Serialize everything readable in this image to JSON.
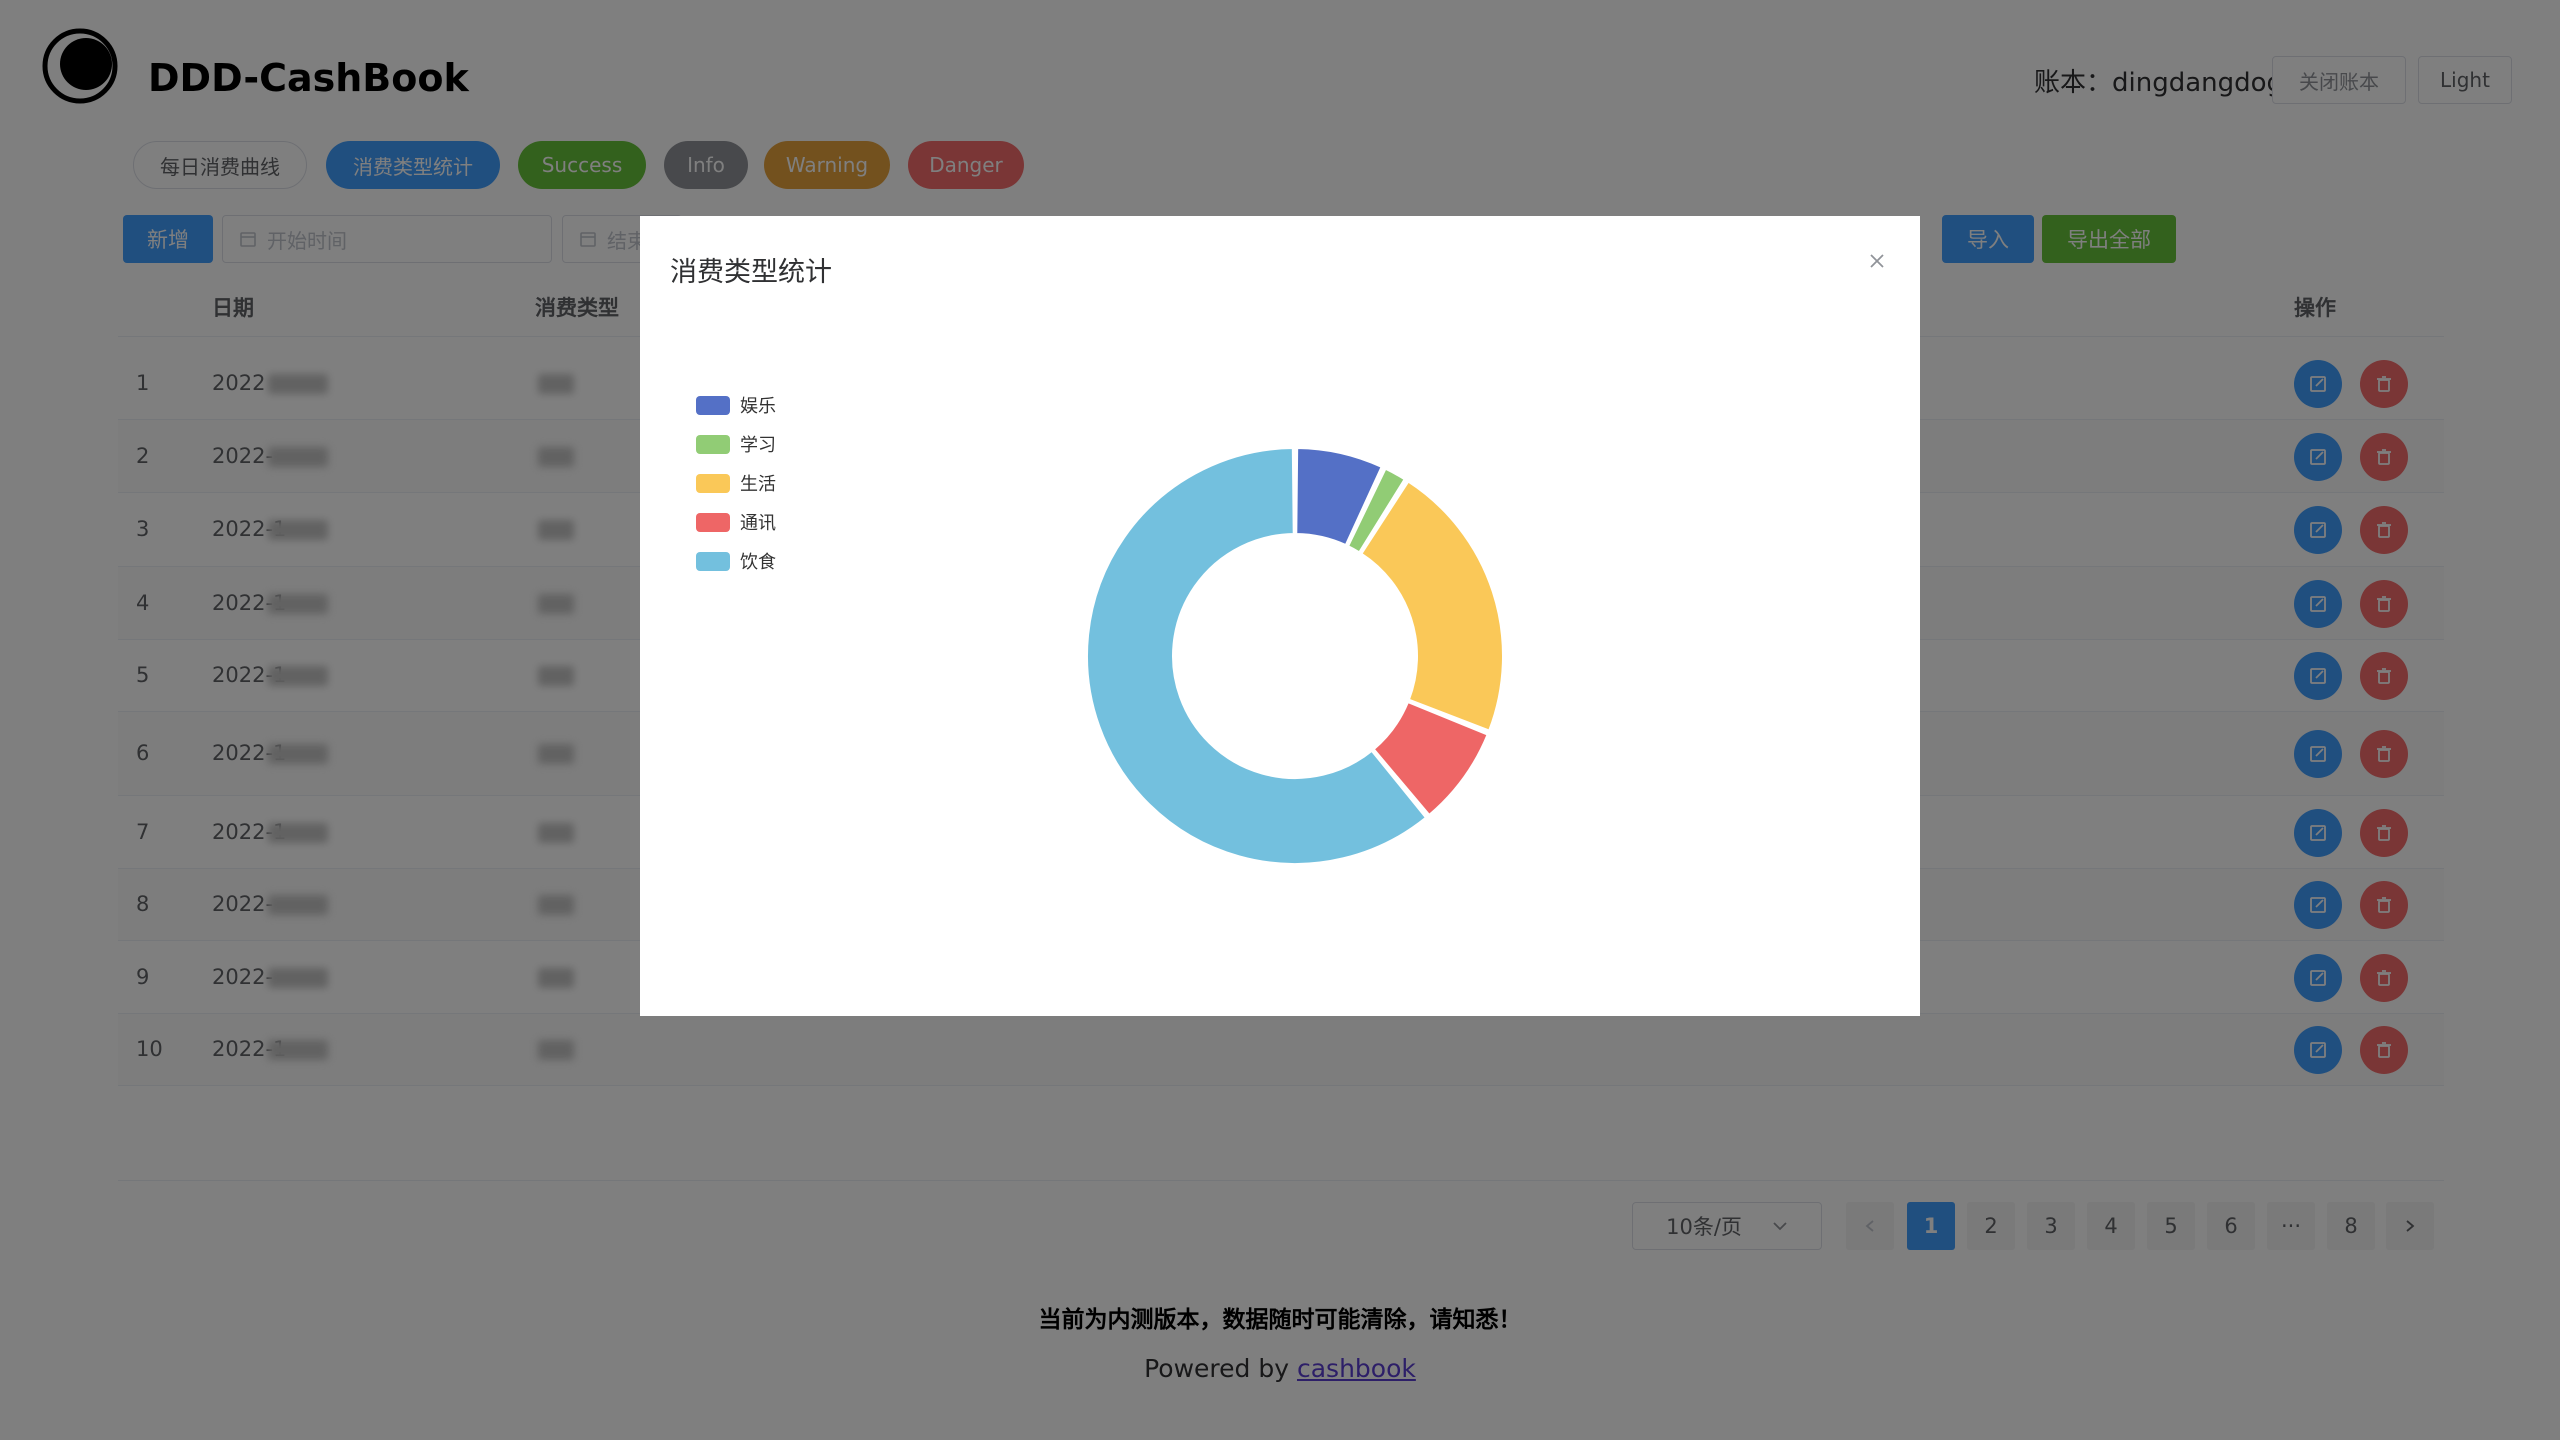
{
  "header": {
    "app_title": "DDD-CashBook",
    "account_label": "账本：dingdangdog",
    "close_book_label": "关闭账本",
    "theme_label": "Light"
  },
  "pills": {
    "daily": "每日消费曲线",
    "type_stats": "消费类型统计",
    "success": "Success",
    "info": "Info",
    "warning": "Warning",
    "danger": "Danger"
  },
  "toolbar": {
    "add_label": "新增",
    "start_placeholder": "开始时间",
    "end_placeholder": "结束",
    "import_label": "导入",
    "export_label": "导出全部"
  },
  "table": {
    "headers": {
      "date": "日期",
      "type": "消费类型",
      "actions": "操作"
    },
    "rows": [
      {
        "index": "1",
        "date": "2022"
      },
      {
        "index": "2",
        "date": "2022-"
      },
      {
        "index": "3",
        "date": "2022-1"
      },
      {
        "index": "4",
        "date": "2022-1"
      },
      {
        "index": "5",
        "date": "2022-1"
      },
      {
        "index": "6",
        "date": "2022-1"
      },
      {
        "index": "7",
        "date": "2022-1"
      },
      {
        "index": "8",
        "date": "2022-"
      },
      {
        "index": "9",
        "date": "2022-"
      },
      {
        "index": "10",
        "date": "2022-1"
      }
    ]
  },
  "pagination": {
    "page_size": "10条/页",
    "pages": [
      "1",
      "2",
      "3",
      "4",
      "5",
      "6",
      "···",
      "8"
    ],
    "current": "1"
  },
  "footer": {
    "notice": "当前为内测版本，数据随时可能清除，请知悉！",
    "powered_prefix": "Powered by ",
    "powered_link": "cashbook"
  },
  "dialog": {
    "title": "消费类型统计"
  },
  "chart_data": {
    "type": "pie",
    "donut": true,
    "legend_position": "top-left",
    "categories": [
      "娱乐",
      "学习",
      "生活",
      "通讯",
      "饮食"
    ],
    "values": [
      7,
      2,
      22,
      8,
      61
    ],
    "colors": [
      "#5470c6",
      "#91cc75",
      "#fac858",
      "#ee6666",
      "#73c0de"
    ]
  },
  "colors": {
    "primary": "#409eff",
    "success": "#67c23a",
    "info": "#909399",
    "warning": "#e6a23c",
    "danger": "#f56c6c"
  }
}
